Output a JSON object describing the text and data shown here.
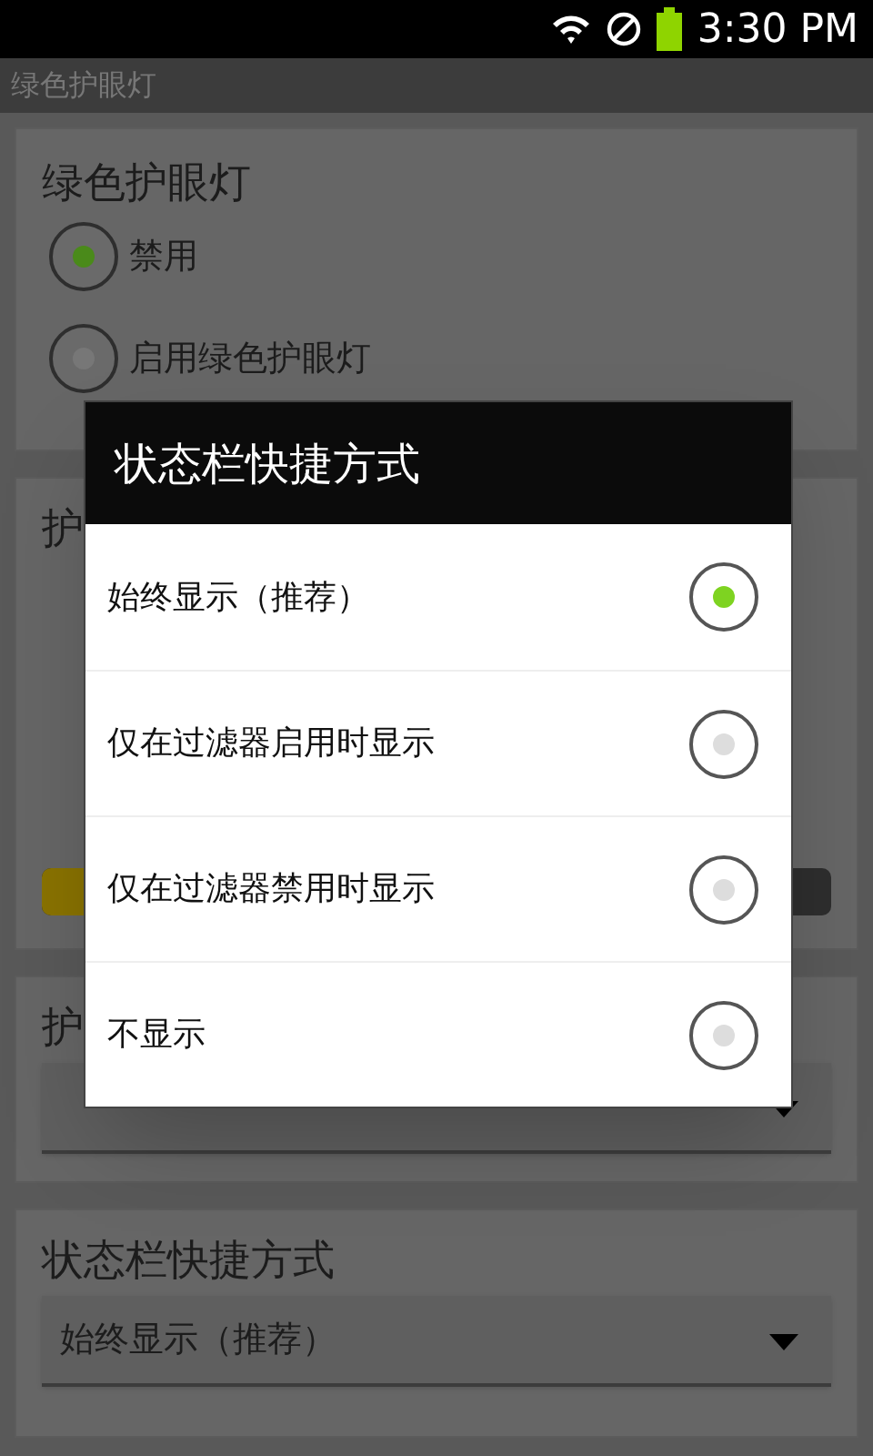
{
  "status_bar": {
    "time": "3:30 PM"
  },
  "app_bar": {
    "title": "绿色护眼灯"
  },
  "sections": [
    {
      "kind": "radio",
      "title": "绿色护眼灯",
      "options": [
        {
          "label": "禁用",
          "selected": true
        },
        {
          "label": "启用绿色护眼灯",
          "selected": false
        }
      ]
    },
    {
      "kind": "slider",
      "title": "护"
    },
    {
      "kind": "dropdown",
      "title": "护"
    },
    {
      "kind": "dropdown",
      "title": "状态栏快捷方式",
      "value": "始终显示（推荐）"
    }
  ],
  "dialog": {
    "title": "状态栏快捷方式",
    "options": [
      {
        "label": "始终显示（推荐）",
        "selected": true
      },
      {
        "label": "仅在过滤器启用时显示",
        "selected": false
      },
      {
        "label": "仅在过滤器禁用时显示",
        "selected": false
      },
      {
        "label": "不显示",
        "selected": false
      }
    ]
  }
}
